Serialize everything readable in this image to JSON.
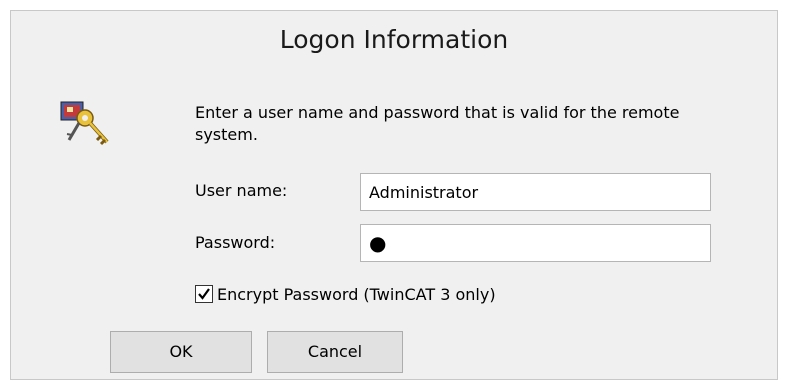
{
  "dialog": {
    "title": "Logon Information",
    "instruction": "Enter a user name and password that is valid for the remote system.",
    "icon": "keys-icon",
    "username": {
      "label": "User name:",
      "value": "Administrator"
    },
    "password": {
      "label": "Password:",
      "value": "●"
    },
    "encrypt": {
      "label": "Encrypt Password (TwinCAT 3 only)",
      "checked": true
    },
    "buttons": {
      "ok": "OK",
      "cancel": "Cancel"
    }
  }
}
